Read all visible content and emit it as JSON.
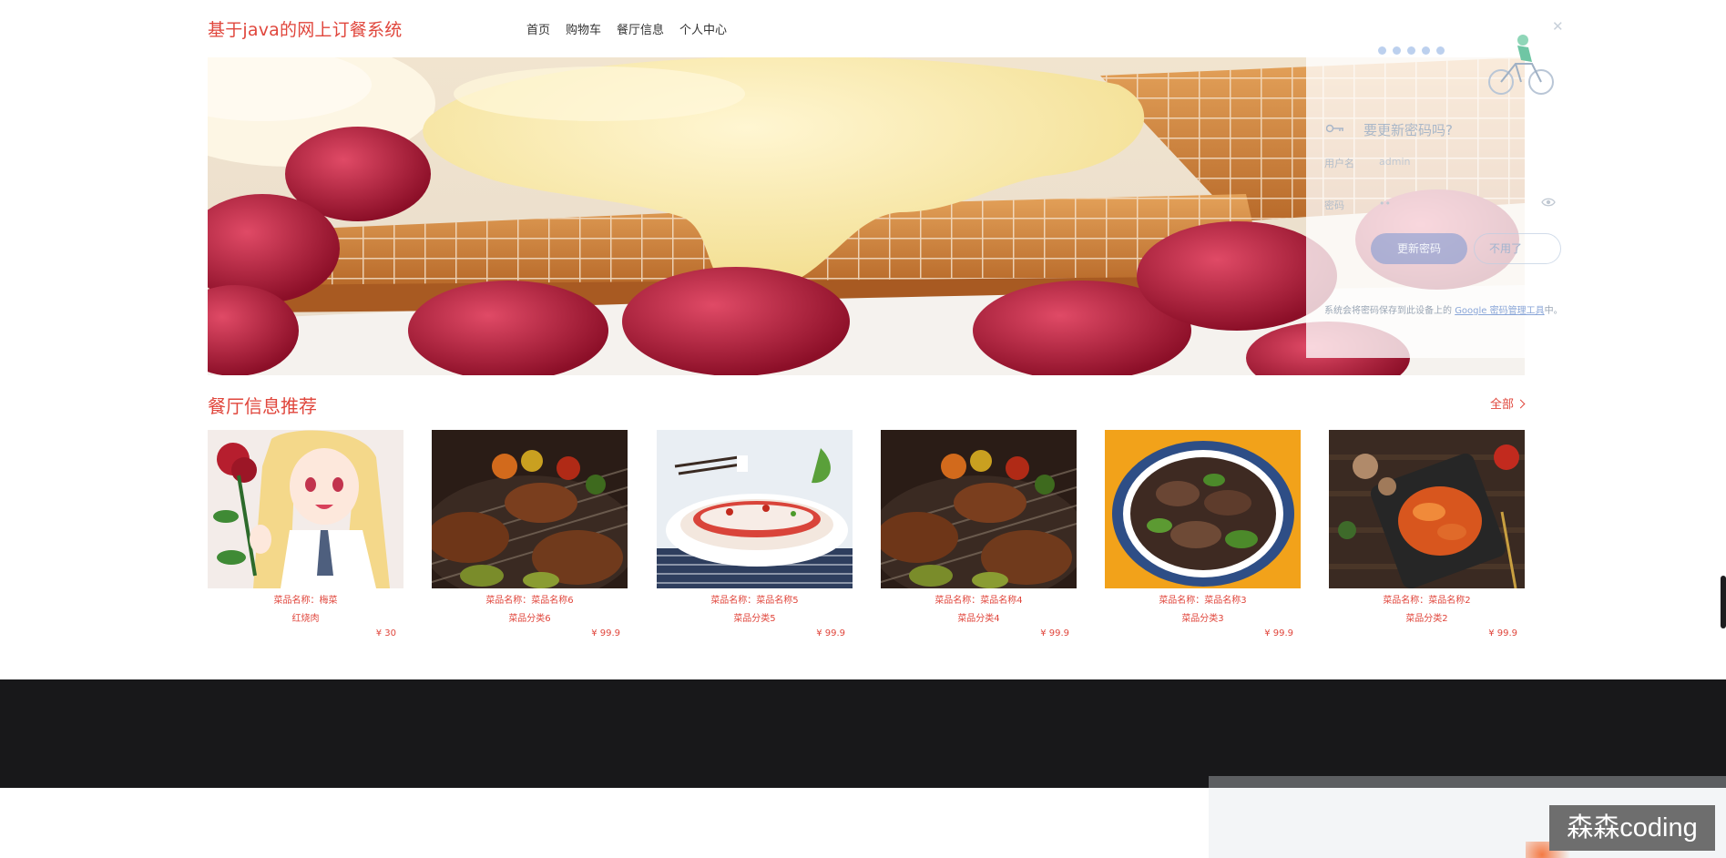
{
  "header": {
    "logo": "基于java的网上订餐系统",
    "nav": [
      "首页",
      "购物车",
      "餐厅信息",
      "个人中心"
    ]
  },
  "password_popup": {
    "title": "要更新密码吗?",
    "username_label": "用户名",
    "username_value": "admin",
    "password_label": "密码",
    "password_value": "••",
    "update_button": "更新密码",
    "later_button": "不用了",
    "note_prefix": "系统会将密码保存到此设备上的 ",
    "note_link": "Google 密码管理工具",
    "note_suffix": "中。"
  },
  "section": {
    "title": "餐厅信息推荐",
    "all_link": "全部"
  },
  "cards": [
    {
      "name": "菜品名称：梅菜",
      "category": "红烧肉",
      "price": "¥ 30"
    },
    {
      "name": "菜品名称：菜品名称6",
      "category": "菜品分类6",
      "price": "¥ 99.9"
    },
    {
      "name": "菜品名称：菜品名称5",
      "category": "菜品分类5",
      "price": "¥ 99.9"
    },
    {
      "name": "菜品名称：菜品名称4",
      "category": "菜品分类4",
      "price": "¥ 99.9"
    },
    {
      "name": "菜品名称：菜品名称3",
      "category": "菜品分类3",
      "price": "¥ 99.9"
    },
    {
      "name": "菜品名称：菜品名称2",
      "category": "菜品分类2",
      "price": "¥ 99.9"
    }
  ],
  "watermark": "森森coding",
  "colors": {
    "accent": "#e0463c",
    "footer": "#18181a"
  }
}
